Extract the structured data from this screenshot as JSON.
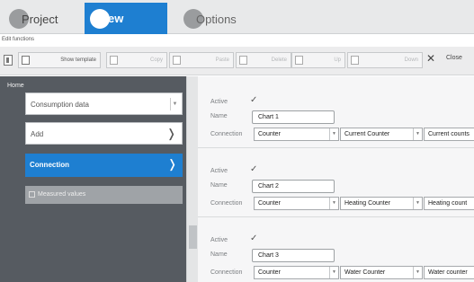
{
  "tabs": {
    "project": "Project",
    "view": "View",
    "options": "Options"
  },
  "subtitle": "Edit functions",
  "toolbar": {
    "show_template": "Show template",
    "btn2": "Copy",
    "btn3": "Paste",
    "btn4": "Delete",
    "btn5": "Up",
    "btn6": "Down",
    "close": "Close"
  },
  "sidebar": {
    "heading": "Home",
    "select_value": "Consumption data",
    "items": [
      {
        "label": "Add"
      },
      {
        "label": "Connection"
      },
      {
        "label": "Measured values"
      }
    ]
  },
  "groups": [
    {
      "active_label": "Active",
      "name_label": "Name",
      "name_value": "Chart 1",
      "connection_label": "Connection",
      "conn_type": "Counter",
      "counter": "Current Counter",
      "counter_detail": "Current counts"
    },
    {
      "active_label": "Active",
      "name_label": "Name",
      "name_value": "Chart 2",
      "connection_label": "Connection",
      "conn_type": "Counter",
      "counter": "Heating Counter",
      "counter_detail": "Heating count"
    },
    {
      "active_label": "Active",
      "name_label": "Name",
      "name_value": "Chart 3",
      "connection_label": "Connection",
      "conn_type": "Counter",
      "counter": "Water Counter",
      "counter_detail": "Water counter"
    }
  ],
  "colors": {
    "accent": "#1e7fd1",
    "sidebar": "#565b61"
  }
}
